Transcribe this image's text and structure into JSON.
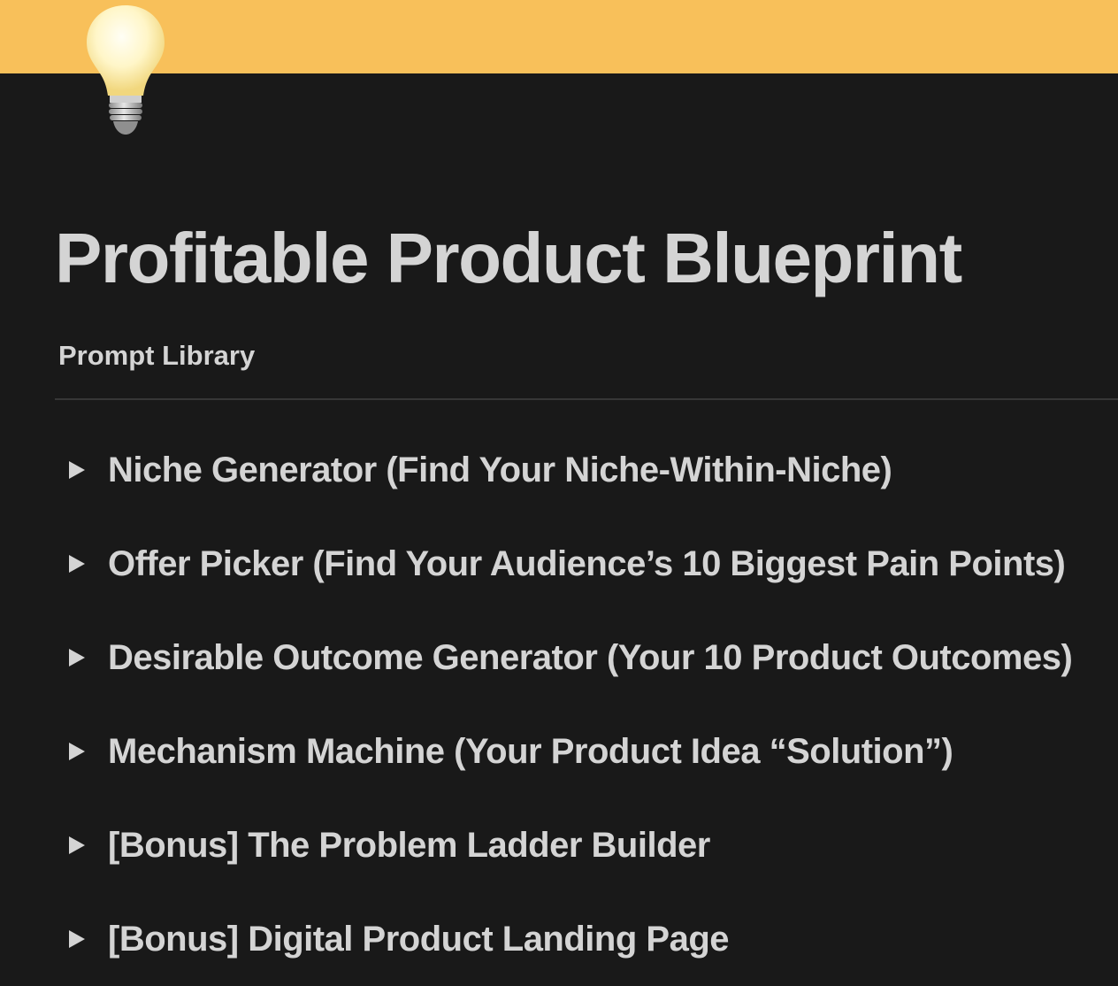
{
  "page": {
    "icon": "lightbulb-icon",
    "title": "Profitable Product Blueprint",
    "cover_color": "#f8c05a",
    "background_color": "#191919"
  },
  "tabs": [
    {
      "label": "Prompt Library",
      "icon": "none"
    }
  ],
  "toggles": [
    {
      "label": "Niche Generator (Find Your Niche-Within-Niche)",
      "icon": "triangle-right-icon"
    },
    {
      "label": "Offer Picker (Find Your Audience’s 10 Biggest Pain Points)",
      "icon": "triangle-right-icon"
    },
    {
      "label": "Desirable Outcome Generator (Your 10 Product Outcomes)",
      "icon": "triangle-right-icon"
    },
    {
      "label": "Mechanism Machine (Your Product Idea “Solution”)",
      "icon": "triangle-right-icon"
    },
    {
      "label": "[Bonus] The Problem Ladder Builder",
      "icon": "triangle-right-icon"
    },
    {
      "label": "[Bonus] Digital Product Landing Page",
      "icon": "triangle-right-icon"
    }
  ]
}
